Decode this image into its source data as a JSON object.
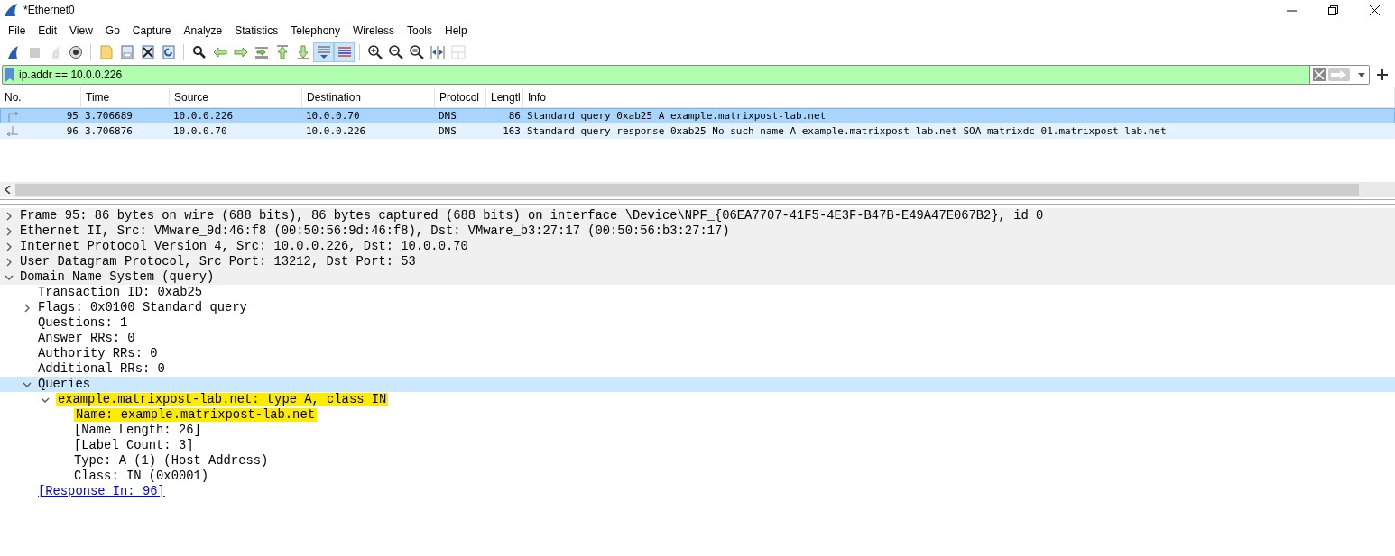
{
  "window": {
    "title": "*Ethernet0"
  },
  "menu": [
    "File",
    "Edit",
    "View",
    "Go",
    "Capture",
    "Analyze",
    "Statistics",
    "Telephony",
    "Wireless",
    "Tools",
    "Help"
  ],
  "toolbar": [
    [
      {
        "kind": "start",
        "on": false,
        "disabled": false
      },
      {
        "kind": "stop",
        "on": false,
        "disabled": true
      },
      {
        "kind": "restart",
        "on": false,
        "disabled": true
      },
      {
        "kind": "options",
        "on": false,
        "disabled": false
      }
    ],
    [
      {
        "kind": "open",
        "on": false,
        "disabled": false
      },
      {
        "kind": "save",
        "on": false,
        "disabled": false
      },
      {
        "kind": "close",
        "on": false,
        "disabled": false
      },
      {
        "kind": "reload",
        "on": false,
        "disabled": false
      }
    ],
    [
      {
        "kind": "find",
        "on": false,
        "disabled": false
      },
      {
        "kind": "back",
        "on": false,
        "disabled": false
      },
      {
        "kind": "forward",
        "on": false,
        "disabled": false
      },
      {
        "kind": "goto",
        "on": false,
        "disabled": false
      },
      {
        "kind": "first",
        "on": false,
        "disabled": false
      },
      {
        "kind": "last",
        "on": false,
        "disabled": false
      },
      {
        "kind": "autoscroll",
        "on": true,
        "disabled": false
      },
      {
        "kind": "colorize",
        "on": true,
        "disabled": false
      }
    ],
    [
      {
        "kind": "zoom-in",
        "on": false,
        "disabled": false
      },
      {
        "kind": "zoom-out",
        "on": false,
        "disabled": false
      },
      {
        "kind": "zoom-reset",
        "on": false,
        "disabled": false
      },
      {
        "kind": "resize-columns",
        "on": false,
        "disabled": false
      },
      {
        "kind": "layout",
        "on": false,
        "disabled": true
      }
    ]
  ],
  "filter": {
    "value": "ip.addr == 10.0.0.226"
  },
  "packet_list": {
    "columns": [
      "No.",
      "Time",
      "Source",
      "Destination",
      "Protocol",
      "Lengtl",
      "Info"
    ],
    "rows": [
      {
        "kind": "request",
        "selected": true,
        "cells": [
          "95",
          "3.706689",
          "10.0.0.226",
          "10.0.0.70",
          "DNS",
          "86",
          "Standard query 0xab25 A example.matrixpost-lab.net"
        ]
      },
      {
        "kind": "response",
        "selected": false,
        "cells": [
          "96",
          "3.706876",
          "10.0.0.70",
          "10.0.0.226",
          "DNS",
          "163",
          "Standard query response 0xab25 No such name A example.matrixpost-lab.net SOA matrixdc-01.matrixpost-lab.net"
        ]
      }
    ]
  },
  "detail_tree": [
    {
      "kind": "branch",
      "expanded": false,
      "selected": false,
      "label": "Frame 95: 86 bytes on wire (688 bits), 86 bytes captured (688 bits) on interface \\Device\\NPF_{06EA7707-41F5-4E3F-B47B-E49A47E067B2}, id 0"
    },
    {
      "kind": "branch",
      "expanded": false,
      "selected": false,
      "label": "Ethernet II, Src: VMware_9d:46:f8 (00:50:56:9d:46:f8), Dst: VMware_b3:27:17 (00:50:56:b3:27:17)"
    },
    {
      "kind": "branch",
      "expanded": false,
      "selected": false,
      "label": "Internet Protocol Version 4, Src: 10.0.0.226, Dst: 10.0.0.70"
    },
    {
      "kind": "branch",
      "expanded": false,
      "selected": false,
      "label": "User Datagram Protocol, Src Port: 13212, Dst Port: 53"
    },
    {
      "kind": "branch",
      "expanded": true,
      "selected": false,
      "label": "Domain Name System (query)",
      "children": [
        {
          "kind": "leaf",
          "selected": false,
          "label": "Transaction ID: 0xab25"
        },
        {
          "kind": "branch",
          "expanded": false,
          "selected": false,
          "label": "Flags: 0x0100 Standard query"
        },
        {
          "kind": "leaf",
          "selected": false,
          "label": "Questions: 1"
        },
        {
          "kind": "leaf",
          "selected": false,
          "label": "Answer RRs: 0"
        },
        {
          "kind": "leaf",
          "selected": false,
          "label": "Authority RRs: 0"
        },
        {
          "kind": "leaf",
          "selected": false,
          "label": "Additional RRs: 0"
        },
        {
          "kind": "branch",
          "expanded": true,
          "selected": true,
          "label": "Queries",
          "children": [
            {
              "kind": "branch",
              "expanded": true,
              "selected": false,
              "highlighted": true,
              "label": "example.matrixpost-lab.net: type A, class IN",
              "children": [
                {
                  "kind": "leaf",
                  "selected": false,
                  "highlighted": true,
                  "label": "Name: example.matrixpost-lab.net"
                },
                {
                  "kind": "leaf",
                  "selected": false,
                  "label": "[Name Length: 26]"
                },
                {
                  "kind": "leaf",
                  "selected": false,
                  "label": "[Label Count: 3]"
                },
                {
                  "kind": "leaf",
                  "selected": false,
                  "label": "Type: A (1) (Host Address)"
                },
                {
                  "kind": "leaf",
                  "selected": false,
                  "label": "Class: IN (0x0001)"
                }
              ]
            }
          ]
        },
        {
          "kind": "link",
          "selected": false,
          "label": "[Response In: 96]"
        }
      ]
    }
  ]
}
